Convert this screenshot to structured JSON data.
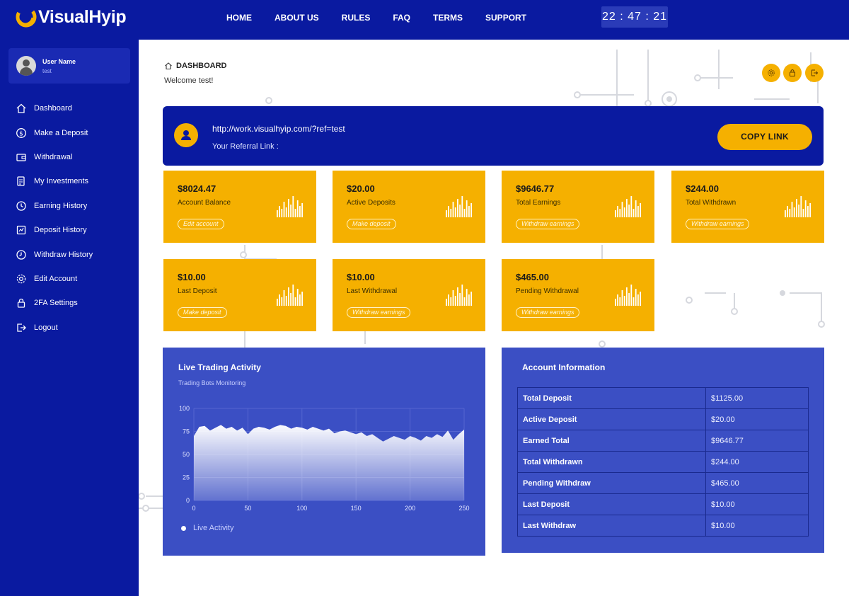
{
  "app": {
    "brand": "VisualHyip",
    "clock": "22 : 47 : 21",
    "nav": [
      {
        "label": "HOME"
      },
      {
        "label": "ABOUT US"
      },
      {
        "label": "RULES"
      },
      {
        "label": "FAQ"
      },
      {
        "label": "TERMS"
      },
      {
        "label": "SUPPORT"
      }
    ]
  },
  "colors": {
    "navy": "#0a1aa0",
    "accent": "#f5b000",
    "panel": "#3b4fc4"
  },
  "user": {
    "name": "User Name",
    "sub": "test"
  },
  "sidebar": {
    "items": [
      {
        "label": "Dashboard",
        "icon": "home-icon"
      },
      {
        "label": "Make a Deposit",
        "icon": "dollar-icon"
      },
      {
        "label": "Withdrawal",
        "icon": "wallet-icon"
      },
      {
        "label": "My Investments",
        "icon": "investments-icon"
      },
      {
        "label": "Earning History",
        "icon": "history-icon"
      },
      {
        "label": "Deposit History",
        "icon": "deposit-history-icon"
      },
      {
        "label": "Withdraw History",
        "icon": "withdraw-history-icon"
      },
      {
        "label": "Edit Account",
        "icon": "gear-icon"
      },
      {
        "label": "2FA Settings",
        "icon": "lock-icon"
      },
      {
        "label": "Logout",
        "icon": "logout-icon"
      }
    ]
  },
  "header": {
    "breadcrumb": "DASHBOARD",
    "welcome": "Welcome test!",
    "actions": [
      {
        "icon": "gear-icon"
      },
      {
        "icon": "lock-icon"
      },
      {
        "icon": "logout-icon"
      }
    ]
  },
  "referral": {
    "url": "http://work.visualhyip.com/?ref=test",
    "label": "Your Referral Link :",
    "button": "COPY LINK"
  },
  "cards": [
    {
      "value": "$8024.47",
      "label": "Account Balance",
      "link": "Edit account"
    },
    {
      "value": "$20.00",
      "label": "Active Deposits",
      "link": "Make deposit"
    },
    {
      "value": "$9646.77",
      "label": "Total Earnings",
      "link": "Withdraw earnings"
    },
    {
      "value": "$244.00",
      "label": "Total Withdrawn",
      "link": "Withdraw earnings"
    },
    {
      "value": "$10.00",
      "label": "Last Deposit",
      "link": "Make deposit"
    },
    {
      "value": "$10.00",
      "label": "Last Withdrawal",
      "link": "Withdraw earnings"
    },
    {
      "value": "$465.00",
      "label": "Pending Withdrawal",
      "link": "Withdraw earnings"
    }
  ],
  "trading": {
    "title": "Live Trading Activity",
    "subtitle": "Trading Bots Monitoring",
    "legend": "Live Activity"
  },
  "chart_data": {
    "type": "area",
    "title": "Live Trading Activity",
    "subtitle": "Trading Bots Monitoring",
    "xlabel": "",
    "ylabel": "",
    "xlim": [
      0,
      250
    ],
    "ylim": [
      0,
      100
    ],
    "xticks": [
      0,
      50,
      100,
      150,
      200,
      250
    ],
    "yticks": [
      0,
      25,
      50,
      75,
      100
    ],
    "grid": true,
    "legend_position": "bottom-left",
    "series": [
      {
        "name": "Live Activity",
        "x": [
          0,
          5,
          10,
          15,
          20,
          25,
          30,
          35,
          40,
          45,
          50,
          55,
          60,
          65,
          70,
          75,
          80,
          85,
          90,
          95,
          100,
          105,
          110,
          115,
          120,
          125,
          130,
          135,
          140,
          145,
          150,
          155,
          160,
          165,
          170,
          175,
          180,
          185,
          190,
          195,
          200,
          205,
          210,
          215,
          220,
          225,
          230,
          235,
          240,
          245,
          250
        ],
        "values": [
          70,
          80,
          81,
          76,
          79,
          82,
          78,
          80,
          76,
          79,
          72,
          78,
          80,
          79,
          77,
          80,
          82,
          81,
          78,
          80,
          79,
          77,
          80,
          78,
          76,
          78,
          73,
          75,
          76,
          74,
          72,
          74,
          70,
          72,
          68,
          64,
          67,
          70,
          68,
          66,
          70,
          68,
          65,
          70,
          68,
          72,
          69,
          76,
          66,
          72,
          77
        ]
      }
    ]
  },
  "account_info": {
    "title": "Account Information",
    "rows": [
      {
        "key": "Total Deposit",
        "value": "$1125.00"
      },
      {
        "key": "Active Deposit",
        "value": "$20.00"
      },
      {
        "key": "Earned Total",
        "value": "$9646.77"
      },
      {
        "key": "Total Withdrawn",
        "value": "$244.00"
      },
      {
        "key": "Pending Withdraw",
        "value": "$465.00"
      },
      {
        "key": "Last Deposit",
        "value": "$10.00"
      },
      {
        "key": "Last Withdraw",
        "value": "$10.00"
      }
    ]
  }
}
